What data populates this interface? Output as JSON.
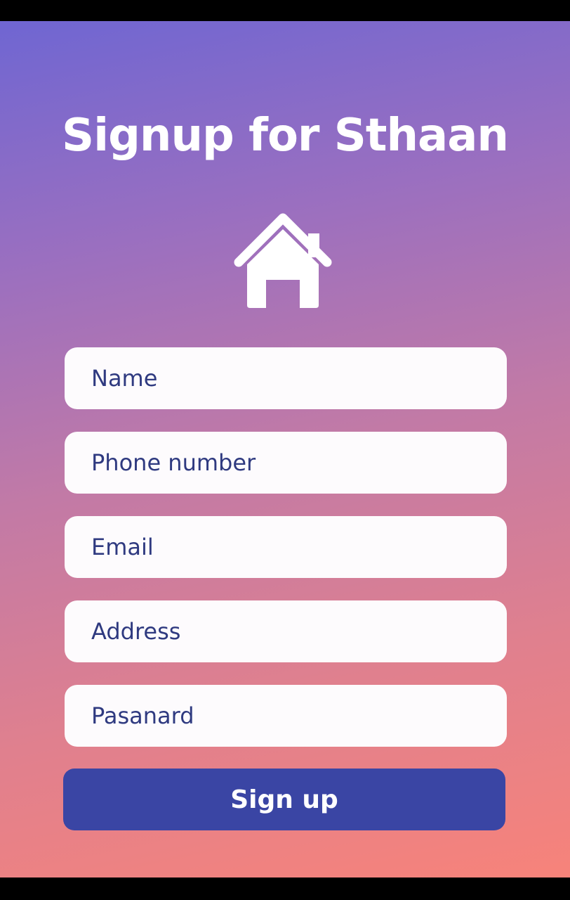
{
  "page": {
    "title": "Signup for Sthaan",
    "icon": "home-icon"
  },
  "form": {
    "name_placeholder": "Name",
    "phone_placeholder": "Phone number",
    "email_placeholder": "Email",
    "address_placeholder": "Address",
    "password_placeholder": "Pasanard",
    "submit_label": "Sign up"
  },
  "colors": {
    "gradient_top": "#6f66d2",
    "gradient_bottom": "#f7837a",
    "button": "#3a45a4",
    "field_text": "#2f3a80"
  }
}
